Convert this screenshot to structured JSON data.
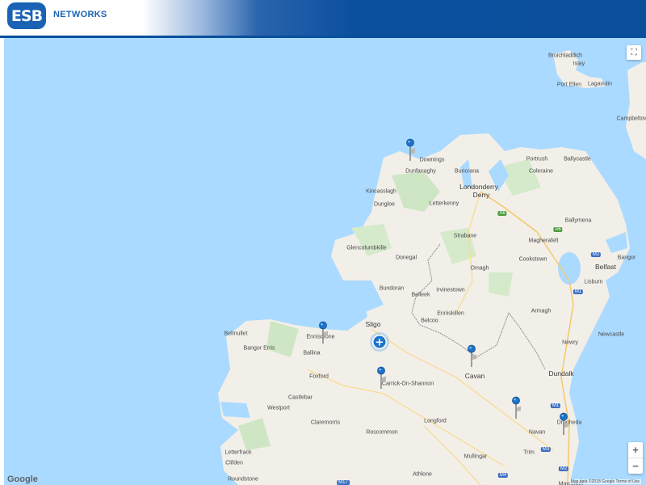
{
  "header": {
    "logo_text": "ESB",
    "brand": "NETWORKS"
  },
  "map": {
    "provider": "Google",
    "attribution": "Map data ©2018 Google   Terms of Use",
    "controls": {
      "fullscreen": "⛶",
      "zoom_in": "+",
      "zoom_out": "−"
    },
    "labels": [
      {
        "t": "Bruichladdich"
      },
      {
        "t": "Islay"
      },
      {
        "t": "Port Ellen"
      },
      {
        "t": "Lagavulin"
      },
      {
        "t": "Campbeltow"
      },
      {
        "t": "Downings"
      },
      {
        "t": "Dunfanaghy"
      },
      {
        "t": "Buncrana"
      },
      {
        "t": "Portrush"
      },
      {
        "t": "Ballycastle"
      },
      {
        "t": "Coleraine"
      },
      {
        "t": "Kincasslagh"
      },
      {
        "t": "Dungloe"
      },
      {
        "t": "Letterkenny"
      },
      {
        "t": "Londonderry"
      },
      {
        "t": "Derry"
      },
      {
        "t": "Ballymena"
      },
      {
        "t": "Strabane"
      },
      {
        "t": "Magherafelt"
      },
      {
        "t": "Glencolumbkille"
      },
      {
        "t": "Donegal"
      },
      {
        "t": "Omagh"
      },
      {
        "t": "Cookstown"
      },
      {
        "t": "Belfast"
      },
      {
        "t": "Bangor"
      },
      {
        "t": "Lisburn"
      },
      {
        "t": "Bundoran"
      },
      {
        "t": "Irvinestown"
      },
      {
        "t": "Belleek"
      },
      {
        "t": "Enniskillen"
      },
      {
        "t": "Armagh"
      },
      {
        "t": "Sligo"
      },
      {
        "t": "Belcoo"
      },
      {
        "t": "Belmullet"
      },
      {
        "t": "Enniscrone"
      },
      {
        "t": "Newry"
      },
      {
        "t": "Newcastle"
      },
      {
        "t": "Bangor Erris"
      },
      {
        "t": "Ballina"
      },
      {
        "t": "Cavan"
      },
      {
        "t": "Dundalk"
      },
      {
        "t": "Foxford"
      },
      {
        "t": "Carrick-On-Shannon"
      },
      {
        "t": "Castlebar"
      },
      {
        "t": "Westport"
      },
      {
        "t": "Drogheda"
      },
      {
        "t": "Claremorris"
      },
      {
        "t": "Longford"
      },
      {
        "t": "Navan"
      },
      {
        "t": "Roscommon"
      },
      {
        "t": "Trim"
      },
      {
        "t": "Letterfrack"
      },
      {
        "t": "Mullingar"
      },
      {
        "t": "Clifden"
      },
      {
        "t": "Roundstone"
      },
      {
        "t": "Athlone"
      },
      {
        "t": "Maynooth"
      }
    ],
    "roads": [
      "A6",
      "A6",
      "M2",
      "M1",
      "M1",
      "M3",
      "M4",
      "M17",
      "M2"
    ],
    "pins": [
      "pin",
      "pin",
      "pin",
      "pin",
      "pin",
      "pin"
    ],
    "cluster": "+"
  }
}
